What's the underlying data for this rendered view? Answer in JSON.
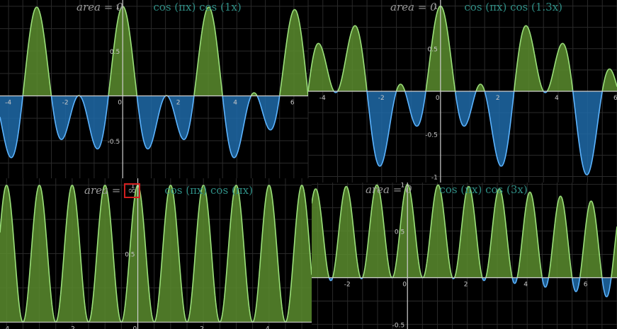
{
  "colors": {
    "positive_fill": "#5a8c2e",
    "positive_line": "#9be07a",
    "negative_fill": "#1f6aa8",
    "negative_line": "#5cb4ff",
    "axis": "#cfcfcf",
    "grid": "#2a2a2a",
    "label_gray": "#9a9a9a",
    "label_teal": "#2f8f86",
    "highlight_box": "#d21f1f"
  },
  "chart_data": [
    {
      "type": "area",
      "panel": "top-left",
      "area_label": "area",
      "area_value": "0",
      "expression": "cos (πx) cos (1x)",
      "k": 1.0,
      "xlim": [
        -4.3,
        6.5
      ],
      "ylim": [
        -0.92,
        1.07
      ],
      "x_ticks": [
        "-4",
        "-2",
        "0",
        "2",
        "4",
        "6"
      ],
      "y_ticks": [
        "1",
        "0.5",
        "-0.5"
      ]
    },
    {
      "type": "area",
      "panel": "top-right",
      "area_label": "area",
      "area_value": "0",
      "expression": "cos (πx) cos (1.3x)",
      "k": 1.3,
      "xlim": [
        -4.5,
        6.0
      ],
      "ylim": [
        -1.07,
        1.07
      ],
      "x_ticks": [
        "-4",
        "-2",
        "0",
        "2",
        "4",
        "6"
      ],
      "y_ticks": [
        "1",
        "0.5",
        "-0.5",
        "-1"
      ]
    },
    {
      "type": "area",
      "panel": "bottom-left",
      "area_label": "area",
      "area_value": "∞",
      "expression": "cos (πx) cos (πx)",
      "k": 3.14159,
      "xlim": [
        -4.2,
        5.3
      ],
      "ylim": [
        -0.05,
        1.05
      ],
      "x_ticks": [
        "-4",
        "-2",
        "0",
        "2",
        "4"
      ],
      "y_ticks": [
        "1",
        "0.5"
      ]
    },
    {
      "type": "area",
      "panel": "bottom-right",
      "area_label": "area",
      "area_value": "0",
      "expression": "cos (πx) cos (3x)",
      "k": 3.0,
      "xlim": [
        -3.2,
        7.0
      ],
      "ylim": [
        -0.55,
        1.02
      ],
      "x_ticks": [
        "-2",
        "0",
        "2",
        "4",
        "6"
      ],
      "y_ticks": [
        "1",
        "0.5",
        "-0.5"
      ]
    }
  ]
}
